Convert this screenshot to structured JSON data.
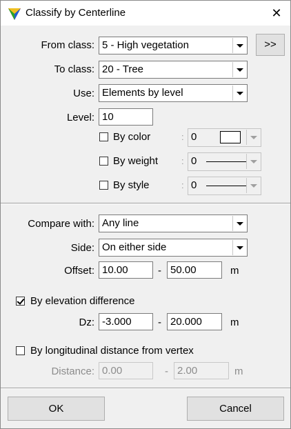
{
  "window": {
    "title": "Classify by Centerline",
    "close_glyph": "✕"
  },
  "from_class": {
    "label": "From class:",
    "value": "5 - High vegetation",
    "more_button": ">>"
  },
  "to_class": {
    "label": "To class:",
    "value": "20 - Tree"
  },
  "use": {
    "label": "Use:",
    "value": "Elements by level"
  },
  "level": {
    "label": "Level:",
    "value": "10"
  },
  "by_color": {
    "label": "By color",
    "checked": false,
    "value": "0",
    "separator": ":"
  },
  "by_weight": {
    "label": "By weight",
    "checked": false,
    "value": "0",
    "separator": ":"
  },
  "by_style": {
    "label": "By style",
    "checked": false,
    "value": "0",
    "separator": ":"
  },
  "compare_with": {
    "label": "Compare with:",
    "value": "Any line"
  },
  "side": {
    "label": "Side:",
    "value": "On either side"
  },
  "offset": {
    "label": "Offset:",
    "min": "10.00",
    "dash": "-",
    "max": "50.00",
    "unit": "m"
  },
  "elevation": {
    "label": "By elevation difference",
    "checked": true
  },
  "dz": {
    "label": "Dz:",
    "min": "-3.000",
    "dash": "-",
    "max": "20.000",
    "unit": "m"
  },
  "longitudinal": {
    "label": "By longitudinal distance from vertex",
    "checked": false
  },
  "distance": {
    "label": "Distance:",
    "min": "0.00",
    "dash": "-",
    "max": "2.00",
    "unit": "m"
  },
  "buttons": {
    "ok": "OK",
    "cancel": "Cancel"
  }
}
